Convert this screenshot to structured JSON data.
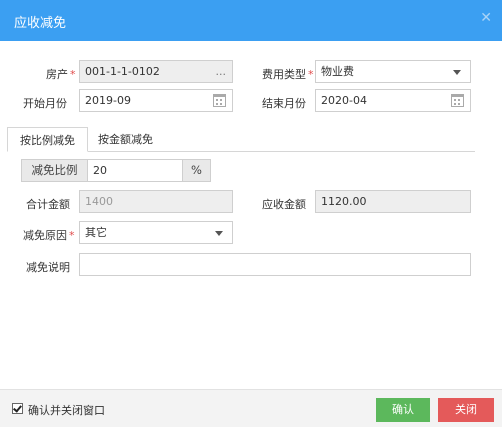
{
  "dialog": {
    "title": "应收减免",
    "close_icon": "close-icon"
  },
  "form": {
    "property": {
      "label": "房产",
      "value": "001-1-1-0102",
      "button": "..."
    },
    "fee_type": {
      "label": "费用类型",
      "value": "物业费"
    },
    "start_month": {
      "label": "开始月份",
      "value": "2019-09"
    },
    "end_month": {
      "label": "结束月份",
      "value": "2020-04"
    }
  },
  "tabs": [
    {
      "label": "按比例减免",
      "active": true
    },
    {
      "label": "按金额减免",
      "active": false
    }
  ],
  "ratio": {
    "label": "减免比例",
    "value": "20",
    "unit": "%"
  },
  "total": {
    "label": "合计金额",
    "placeholder": "1400"
  },
  "receivable": {
    "label": "应收金额",
    "value": "1120.00"
  },
  "reason": {
    "label": "减免原因",
    "value": "其它"
  },
  "note": {
    "label": "减免说明",
    "value": ""
  },
  "footer": {
    "checkbox_label": "确认并关闭窗口",
    "checked": true,
    "confirm": "确认",
    "close": "关闭"
  },
  "colors": {
    "titlebar": "#3b9ff2",
    "confirm": "#5cb85c",
    "close": "#e45a5a",
    "required": "#e04b4b"
  }
}
